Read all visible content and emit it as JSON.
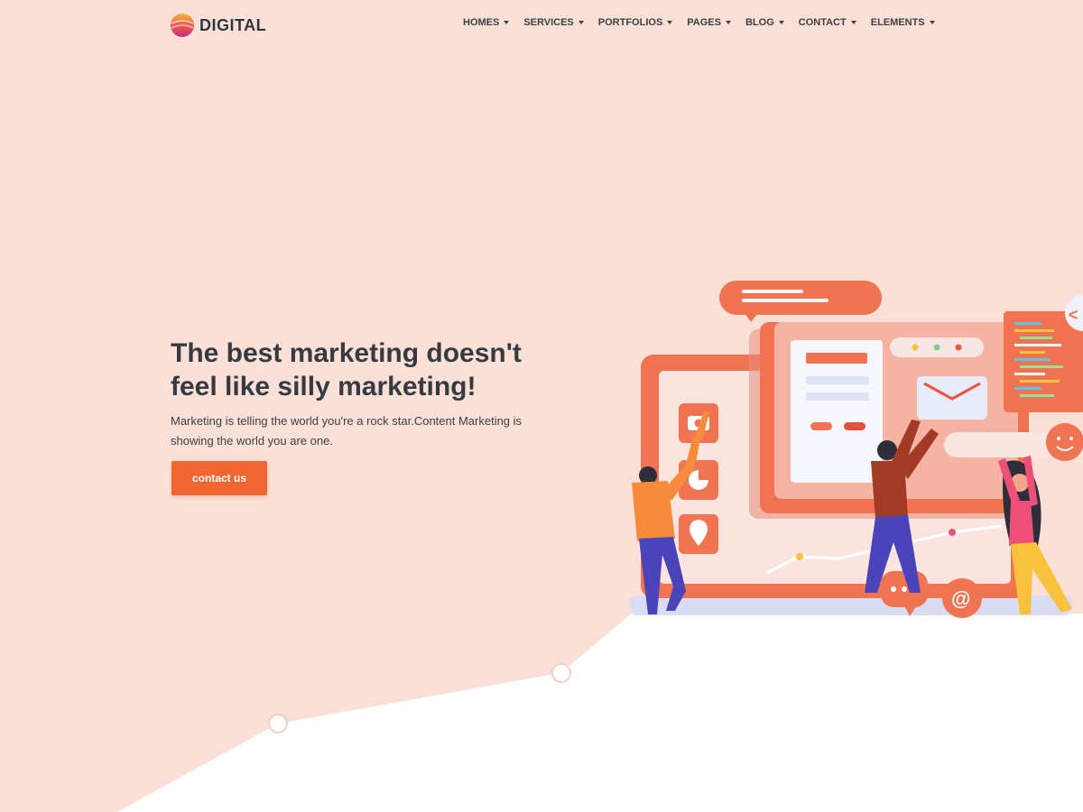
{
  "brand": {
    "name": "DIGITAL"
  },
  "nav": {
    "items": [
      {
        "label": "HOMES"
      },
      {
        "label": "SERVICES"
      },
      {
        "label": "PORTFOLIOS"
      },
      {
        "label": "PAGES"
      },
      {
        "label": "BLOG"
      },
      {
        "label": "CONTACT"
      },
      {
        "label": "ELEMENTS"
      }
    ]
  },
  "hero": {
    "title": "The best marketing doesn't feel like silly marketing!",
    "text": "Marketing is telling the world you're a rock star.Content Marketing is showing the world you are one.",
    "cta_label": "contact us"
  },
  "illustration": {
    "email_symbol": "@",
    "code_symbol": "<"
  },
  "colors": {
    "background": "#fbe0d7",
    "accent": "#f06633",
    "heading": "#363a42",
    "coral": "#f07452"
  }
}
